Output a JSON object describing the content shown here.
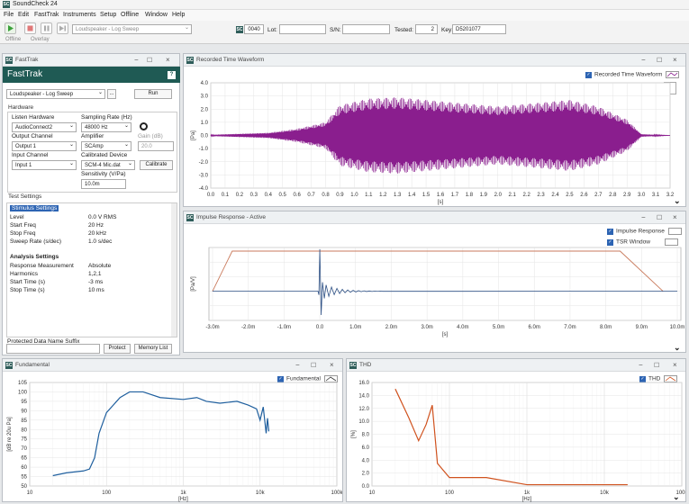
{
  "app": {
    "title": "SoundCheck 24",
    "icon": "SC"
  },
  "menu": [
    "File",
    "Edit",
    "FastTrak",
    "Instruments",
    "Setup",
    "Offline",
    "Window",
    "Help"
  ],
  "toolbar": {
    "offline": "Offline",
    "overlay": "Overlay",
    "sequence": "Loudspeaker - Log Sweep",
    "counter": "0040",
    "lot_label": "Lot:",
    "sn_label": "S/N:",
    "tested_label": "Tested:",
    "tested_value": "2",
    "key_label": "Key:",
    "key_value": "D5201077"
  },
  "fasttrak": {
    "window_title": "FastTrak",
    "header": "FastTrak",
    "help": "?",
    "sequence_select": "Loudspeaker - Log Sweep",
    "run": "Run",
    "hardware_label": "Hardware",
    "listen_hw_label": "Listen Hardware",
    "listen_hw": "AudioConnect2",
    "sampling_label": "Sampling Rate (Hz)",
    "sampling": "48000 Hz",
    "output_ch_label": "Output Channel",
    "output_ch": "Output 1",
    "amplifier_label": "Amplifier",
    "amplifier": "SCAmp",
    "gain_label": "Gain (dB)",
    "gain": "20.0",
    "input_ch_label": "Input Channel",
    "input_ch": "Input 1",
    "cal_dev_label": "Calibrated Device",
    "cal_dev": "SCM-4 Mic.dat",
    "calibrate": "Calibrate",
    "sensitivity_label": "Sensitivity (V/Pa)",
    "sensitivity": "10.0m",
    "test_settings_label": "Test Settings",
    "stim_header": "Stimulus Settings",
    "stim_rows": [
      [
        "Level",
        "0.0 V RMS"
      ],
      [
        "Start Freq",
        "20 Hz"
      ],
      [
        "Stop Freq",
        "20 kHz"
      ],
      [
        "Sweep Rate (s/dec)",
        "1.0 s/dec"
      ]
    ],
    "analysis_header": "Analysis Settings",
    "analysis_rows": [
      [
        "Response Measurement",
        "Absolute"
      ],
      [
        "Harmonics",
        "1,2,1"
      ],
      [
        "Start Time (s)",
        "-3 ms"
      ],
      [
        "Stop Time (s)",
        "10 ms"
      ]
    ],
    "protected_label": "Protected Data Name Suffix",
    "protect": "Protect",
    "memory_list": "Memory List"
  },
  "waveform": {
    "title": "Recorded Time Waveform",
    "legend": "Recorded Time Waveform",
    "ylabel": "[Pa]",
    "xlabel": "[s]",
    "color": "#8a1e8e",
    "yticks": [
      "4.0",
      "3.0",
      "2.0",
      "1.0",
      "0.0",
      "-1.0",
      "-2.0",
      "-3.0",
      "-4.0"
    ],
    "xticks": [
      "0.0",
      "0.1",
      "0.2",
      "0.3",
      "0.4",
      "0.5",
      "0.6",
      "0.7",
      "0.8",
      "0.9",
      "1.0",
      "1.1",
      "1.2",
      "1.3",
      "1.4",
      "1.5",
      "1.6",
      "1.7",
      "1.8",
      "1.9",
      "2.0",
      "2.1",
      "2.2",
      "2.3",
      "2.4",
      "2.5",
      "2.6",
      "2.7",
      "2.8",
      "2.9",
      "3.0",
      "3.1",
      "3.2"
    ]
  },
  "impulse": {
    "title": "Impulse Response - Active",
    "legend1": "Impulse Response",
    "legend2": "TSR Window",
    "ylabel": "[Pa/V]",
    "xlabel": "[s]",
    "xticks": [
      "-3.0m",
      "-2.0m",
      "-1.0m",
      "0.0",
      "1.0m",
      "2.0m",
      "3.0m",
      "4.0m",
      "5.0m",
      "6.0m",
      "7.0m",
      "8.0m",
      "9.0m",
      "10.0m"
    ]
  },
  "fundamental": {
    "title": "Fundamental",
    "legend": "Fundamental",
    "color": "#1f5f9e",
    "ylabel": "[dB re 20u Pa]",
    "xlabel": "[Hz]",
    "yticks": [
      "105",
      "100",
      "95",
      "90",
      "85",
      "80",
      "75",
      "70",
      "65",
      "60",
      "55",
      "50"
    ],
    "xticks": [
      "10",
      "100",
      "1k",
      "10k",
      "100k"
    ]
  },
  "thd": {
    "title": "THD",
    "legend": "THD",
    "color": "#d0521e",
    "ylabel": "[%]",
    "xlabel": "[Hz]",
    "yticks": [
      "16.0",
      "14.0",
      "12.0",
      "10.0",
      "8.0",
      "6.0",
      "4.0",
      "2.0",
      "0.0"
    ],
    "xticks": [
      "10",
      "100",
      "1k",
      "10k",
      "100k"
    ]
  },
  "chart_data": [
    {
      "type": "line",
      "title": "Recorded Time Waveform",
      "xlabel": "[s]",
      "ylabel": "[Pa]",
      "xlim": [
        0,
        3.2
      ],
      "ylim": [
        -4,
        4
      ],
      "series": [
        {
          "name": "Recorded Time Waveform",
          "x": [
            0.0,
            0.4,
            0.6,
            0.8,
            0.9,
            1.1,
            1.3,
            1.6,
            2.0,
            2.2,
            2.5,
            2.7,
            2.9,
            3.0,
            3.2
          ],
          "y_envelope": [
            0.05,
            0.2,
            0.5,
            1.0,
            2.3,
            2.8,
            2.9,
            2.6,
            2.2,
            2.4,
            2.7,
            2.2,
            1.2,
            0.1,
            0.0
          ]
        }
      ]
    },
    {
      "type": "line",
      "title": "Impulse Response - Active",
      "xlabel": "[s]",
      "ylabel": "[Pa/V]",
      "series": [
        {
          "name": "Impulse Response"
        },
        {
          "name": "TSR Window"
        }
      ]
    },
    {
      "type": "line",
      "title": "Fundamental",
      "xlabel": "[Hz]",
      "ylabel": "[dB re 20u Pa]",
      "xscale": "log",
      "xlim": [
        10,
        100000
      ],
      "ylim": [
        50,
        105
      ],
      "series": [
        {
          "name": "Fundamental",
          "x": [
            20,
            30,
            50,
            60,
            70,
            80,
            100,
            150,
            200,
            300,
            500,
            1000,
            1500,
            2000,
            3000,
            5000,
            7000,
            9000,
            10000,
            11000,
            12000,
            12500,
            13000
          ],
          "y": [
            55.5,
            57,
            58,
            59,
            65,
            78,
            89,
            97,
            100,
            100,
            97,
            96,
            97,
            95,
            94,
            95,
            93,
            91,
            85,
            92,
            78,
            86,
            79
          ]
        }
      ]
    },
    {
      "type": "line",
      "title": "THD",
      "xlabel": "[Hz]",
      "ylabel": "[%]",
      "xscale": "log",
      "xlim": [
        10,
        100000
      ],
      "ylim": [
        0,
        16
      ],
      "series": [
        {
          "name": "THD",
          "x": [
            20,
            30,
            40,
            50,
            60,
            70,
            100,
            300,
            1000,
            10000,
            20000
          ],
          "y": [
            15.0,
            10.5,
            7.0,
            9.5,
            12.5,
            3.5,
            1.3,
            1.3,
            0.2,
            0.2,
            0.2
          ]
        }
      ]
    }
  ]
}
